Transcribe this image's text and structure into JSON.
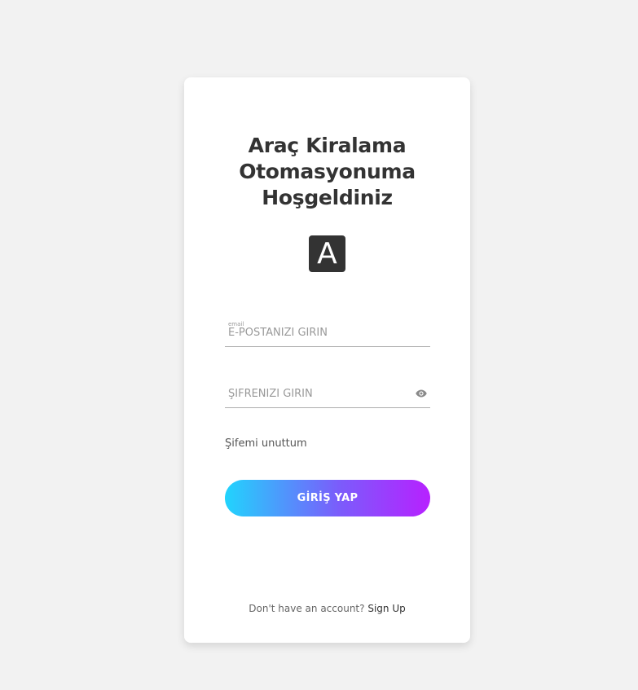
{
  "login": {
    "title_line1": "Araç Kiralama",
    "title_line2": "Otomasyonuma",
    "title_line3": "Hoşgeldiniz",
    "logo_letter": "A",
    "email": {
      "placeholder": "E-POSTANIZI GİRİN",
      "icon_label": "email",
      "value": ""
    },
    "password": {
      "placeholder": "ŞİFRENİZİ GİRİN",
      "icon": "eye-icon",
      "value": ""
    },
    "forgot_label": "Şifemi unuttum",
    "submit_label": "GİRİŞ YAP",
    "signup_prompt": "Don't have an account?",
    "signup_link": "Sign Up"
  },
  "colors": {
    "background": "#f2f2f2",
    "card": "#ffffff",
    "text_dark": "#333333",
    "gradient_start": "#21d4fd",
    "gradient_end": "#b721ff"
  }
}
